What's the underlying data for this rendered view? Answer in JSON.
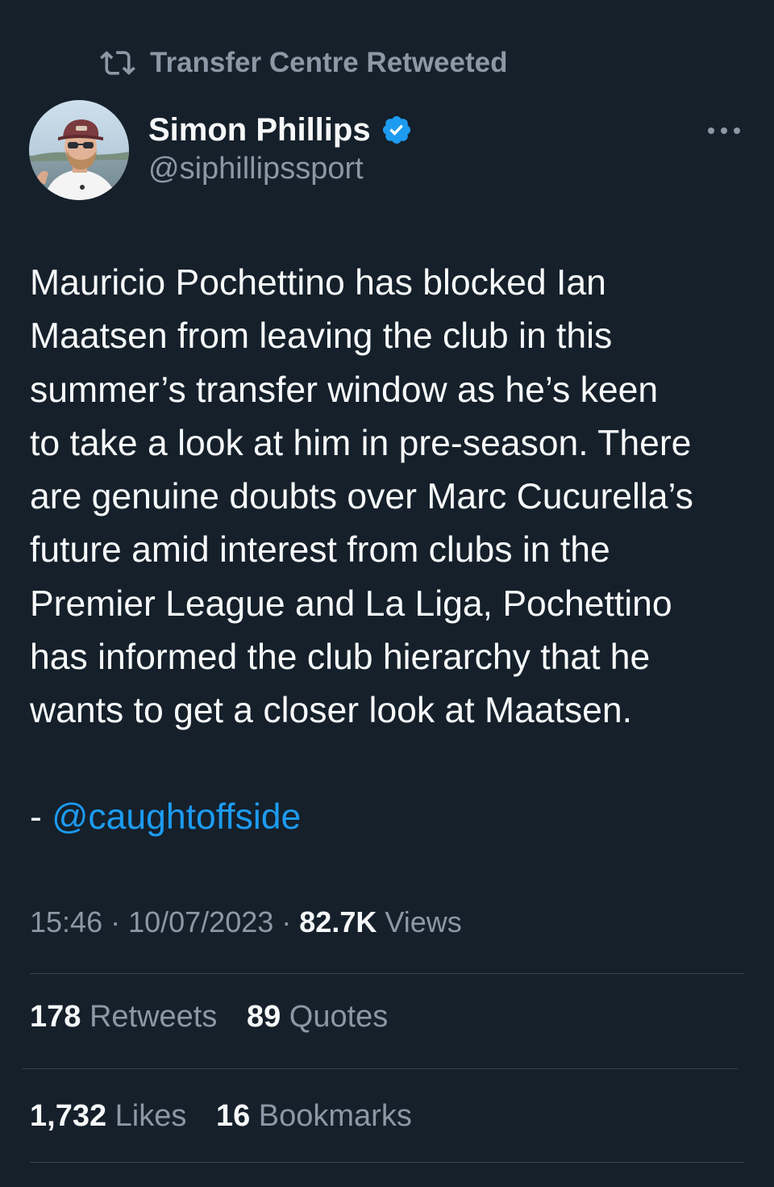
{
  "retweet": {
    "label": "Transfer Centre Retweeted",
    "icon": "retweet-icon"
  },
  "author": {
    "name": "Simon Phillips",
    "handle": "@siphillipssport",
    "verified_icon": "verified-badge-icon",
    "verified_color": "#1d9bf0"
  },
  "more_icon": "more-options-icon",
  "tweet": {
    "lines": [
      "Mauricio Pochettino has blocked Ian",
      "Maatsen from leaving the club in this",
      "summer’s transfer window as he’s keen",
      "to take a look at him in pre-season. There",
      "are genuine doubts over Marc Cucurella’s",
      "future amid interest from clubs in the",
      "Premier League and La Liga, Pochettino",
      "has informed the club hierarchy that he",
      "wants to get a closer look at Maatsen."
    ],
    "credit_prefix": "- ",
    "credit_mention": "@caughtoffside"
  },
  "meta": {
    "time": "15:46",
    "sep1": " · ",
    "date": "10/07/2023",
    "sep2": " · ",
    "views_count": "82.7K",
    "views_label": " Views"
  },
  "stats": {
    "retweets_count": "178",
    "retweets_label": " Retweets",
    "quotes_count": "89",
    "quotes_label": " Quotes",
    "likes_count": "1,732",
    "likes_label": " Likes",
    "bookmarks_count": "16",
    "bookmarks_label": " Bookmarks"
  },
  "colors": {
    "background": "#15202b",
    "text": "#f7f9f9",
    "secondary": "#8b98a5",
    "accent": "#1d9bf0",
    "divider": "#38444d"
  }
}
